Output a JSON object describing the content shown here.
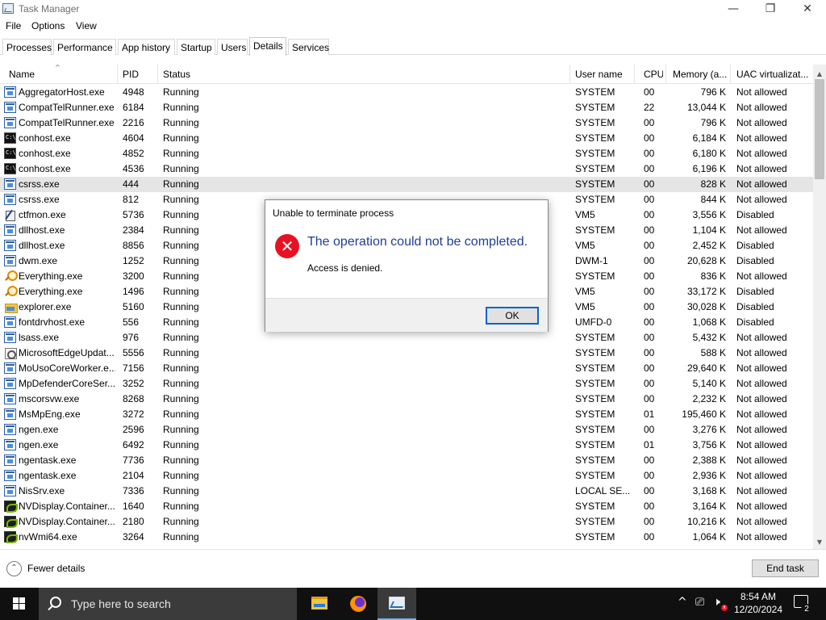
{
  "window": {
    "title": "Task Manager",
    "minimize_glyph": "—",
    "restore_glyph": "❐",
    "close_glyph": "✕"
  },
  "menu": [
    "File",
    "Options",
    "View"
  ],
  "tabs": [
    "Processes",
    "Performance",
    "App history",
    "Startup",
    "Users",
    "Details",
    "Services"
  ],
  "active_tab": "Details",
  "columns": [
    "Name",
    "PID",
    "Status",
    "User name",
    "CPU",
    "Memory (a...",
    "UAC virtualizat..."
  ],
  "sort_glyph": "^",
  "rows": [
    {
      "icon": "window-app-icon",
      "name": "AggregatorHost.exe",
      "pid": "4948",
      "status": "Running",
      "user": "SYSTEM",
      "cpu": "00",
      "mem": "796 K",
      "uac": "Not allowed"
    },
    {
      "icon": "window-app-icon",
      "name": "CompatTelRunner.exe",
      "pid": "6184",
      "status": "Running",
      "user": "SYSTEM",
      "cpu": "22",
      "mem": "13,044 K",
      "uac": "Not allowed"
    },
    {
      "icon": "window-app-icon",
      "name": "CompatTelRunner.exe",
      "pid": "2216",
      "status": "Running",
      "user": "SYSTEM",
      "cpu": "00",
      "mem": "796 K",
      "uac": "Not allowed"
    },
    {
      "icon": "console-icon",
      "name": "conhost.exe",
      "pid": "4604",
      "status": "Running",
      "user": "SYSTEM",
      "cpu": "00",
      "mem": "6,184 K",
      "uac": "Not allowed"
    },
    {
      "icon": "console-icon",
      "name": "conhost.exe",
      "pid": "4852",
      "status": "Running",
      "user": "SYSTEM",
      "cpu": "00",
      "mem": "6,180 K",
      "uac": "Not allowed"
    },
    {
      "icon": "console-icon",
      "name": "conhost.exe",
      "pid": "4536",
      "status": "Running",
      "user": "SYSTEM",
      "cpu": "00",
      "mem": "6,196 K",
      "uac": "Not allowed"
    },
    {
      "icon": "window-app-icon",
      "name": "csrss.exe",
      "pid": "444",
      "status": "Running",
      "user": "SYSTEM",
      "cpu": "00",
      "mem": "828 K",
      "uac": "Not allowed",
      "selected": true
    },
    {
      "icon": "window-app-icon",
      "name": "csrss.exe",
      "pid": "812",
      "status": "Running",
      "user": "SYSTEM",
      "cpu": "00",
      "mem": "844 K",
      "uac": "Not allowed"
    },
    {
      "icon": "pen-icon",
      "name": "ctfmon.exe",
      "pid": "5736",
      "status": "Running",
      "user": "VM5",
      "cpu": "00",
      "mem": "3,556 K",
      "uac": "Disabled"
    },
    {
      "icon": "window-app-icon",
      "name": "dllhost.exe",
      "pid": "2384",
      "status": "Running",
      "user": "SYSTEM",
      "cpu": "00",
      "mem": "1,104 K",
      "uac": "Not allowed"
    },
    {
      "icon": "window-app-icon",
      "name": "dllhost.exe",
      "pid": "8856",
      "status": "Running",
      "user": "VM5",
      "cpu": "00",
      "mem": "2,452 K",
      "uac": "Disabled"
    },
    {
      "icon": "window-app-icon",
      "name": "dwm.exe",
      "pid": "1252",
      "status": "Running",
      "user": "DWM-1",
      "cpu": "00",
      "mem": "20,628 K",
      "uac": "Disabled"
    },
    {
      "icon": "magnifier-icon",
      "name": "Everything.exe",
      "pid": "3200",
      "status": "Running",
      "user": "SYSTEM",
      "cpu": "00",
      "mem": "836 K",
      "uac": "Not allowed"
    },
    {
      "icon": "magnifier-icon",
      "name": "Everything.exe",
      "pid": "1496",
      "status": "Running",
      "user": "VM5",
      "cpu": "00",
      "mem": "33,172 K",
      "uac": "Disabled"
    },
    {
      "icon": "folder-icon",
      "name": "explorer.exe",
      "pid": "5160",
      "status": "Running",
      "user": "VM5",
      "cpu": "00",
      "mem": "30,028 K",
      "uac": "Disabled"
    },
    {
      "icon": "window-app-icon",
      "name": "fontdrvhost.exe",
      "pid": "556",
      "status": "Running",
      "user": "UMFD-0",
      "cpu": "00",
      "mem": "1,068 K",
      "uac": "Disabled"
    },
    {
      "icon": "window-app-icon",
      "name": "lsass.exe",
      "pid": "976",
      "status": "Running",
      "user": "SYSTEM",
      "cpu": "00",
      "mem": "5,432 K",
      "uac": "Not allowed"
    },
    {
      "icon": "gear-icon",
      "name": "MicrosoftEdgeUpdat...",
      "pid": "5556",
      "status": "Running",
      "user": "SYSTEM",
      "cpu": "00",
      "mem": "588 K",
      "uac": "Not allowed"
    },
    {
      "icon": "window-app-icon",
      "name": "MoUsoCoreWorker.e...",
      "pid": "7156",
      "status": "Running",
      "user": "SYSTEM",
      "cpu": "00",
      "mem": "29,640 K",
      "uac": "Not allowed"
    },
    {
      "icon": "window-app-icon",
      "name": "MpDefenderCoreSer...",
      "pid": "3252",
      "status": "Running",
      "user": "SYSTEM",
      "cpu": "00",
      "mem": "5,140 K",
      "uac": "Not allowed"
    },
    {
      "icon": "window-app-icon",
      "name": "mscorsvw.exe",
      "pid": "8268",
      "status": "Running",
      "user": "SYSTEM",
      "cpu": "00",
      "mem": "2,232 K",
      "uac": "Not allowed"
    },
    {
      "icon": "window-app-icon",
      "name": "MsMpEng.exe",
      "pid": "3272",
      "status": "Running",
      "user": "SYSTEM",
      "cpu": "01",
      "mem": "195,460 K",
      "uac": "Not allowed"
    },
    {
      "icon": "window-app-icon",
      "name": "ngen.exe",
      "pid": "2596",
      "status": "Running",
      "user": "SYSTEM",
      "cpu": "00",
      "mem": "3,276 K",
      "uac": "Not allowed"
    },
    {
      "icon": "window-app-icon",
      "name": "ngen.exe",
      "pid": "6492",
      "status": "Running",
      "user": "SYSTEM",
      "cpu": "01",
      "mem": "3,756 K",
      "uac": "Not allowed"
    },
    {
      "icon": "window-app-icon",
      "name": "ngentask.exe",
      "pid": "7736",
      "status": "Running",
      "user": "SYSTEM",
      "cpu": "00",
      "mem": "2,388 K",
      "uac": "Not allowed"
    },
    {
      "icon": "window-app-icon",
      "name": "ngentask.exe",
      "pid": "2104",
      "status": "Running",
      "user": "SYSTEM",
      "cpu": "00",
      "mem": "2,936 K",
      "uac": "Not allowed"
    },
    {
      "icon": "window-app-icon",
      "name": "NisSrv.exe",
      "pid": "7336",
      "status": "Running",
      "user": "LOCAL SE...",
      "cpu": "00",
      "mem": "3,168 K",
      "uac": "Not allowed"
    },
    {
      "icon": "nvidia-icon",
      "name": "NVDisplay.Container...",
      "pid": "1640",
      "status": "Running",
      "user": "SYSTEM",
      "cpu": "00",
      "mem": "3,164 K",
      "uac": "Not allowed"
    },
    {
      "icon": "nvidia-icon",
      "name": "NVDisplay.Container...",
      "pid": "2180",
      "status": "Running",
      "user": "SYSTEM",
      "cpu": "00",
      "mem": "10,216 K",
      "uac": "Not allowed"
    },
    {
      "icon": "nvidia-icon",
      "name": "nvWmi64.exe",
      "pid": "3264",
      "status": "Running",
      "user": "SYSTEM",
      "cpu": "00",
      "mem": "1,064 K",
      "uac": "Not allowed"
    }
  ],
  "scrollbar": {
    "up_glyph": "▲",
    "down_glyph": "▼"
  },
  "footer": {
    "fewer_glyph": "⌃",
    "fewer_label": "Fewer details",
    "end_task_label": "End task"
  },
  "dialog": {
    "title": "Unable to terminate process",
    "icon_glyph": "✕",
    "main_instruction": "The operation could not be completed.",
    "content": "Access is denied.",
    "ok_label": "OK",
    "colors": {
      "instruction": "#1f3f8f",
      "error": "#e81123"
    }
  },
  "taskbar": {
    "search_placeholder": "Type here to search",
    "apps": [
      "folder-icon",
      "firefox-icon",
      "task-manager-icon"
    ],
    "tray": {
      "chevron_glyph": "^",
      "network_glyph": "⎚",
      "volume_glyph": "🕨",
      "mute_glyph": "x",
      "time": "8:54 AM",
      "date": "12/20/2024",
      "notification_count": "2"
    }
  }
}
